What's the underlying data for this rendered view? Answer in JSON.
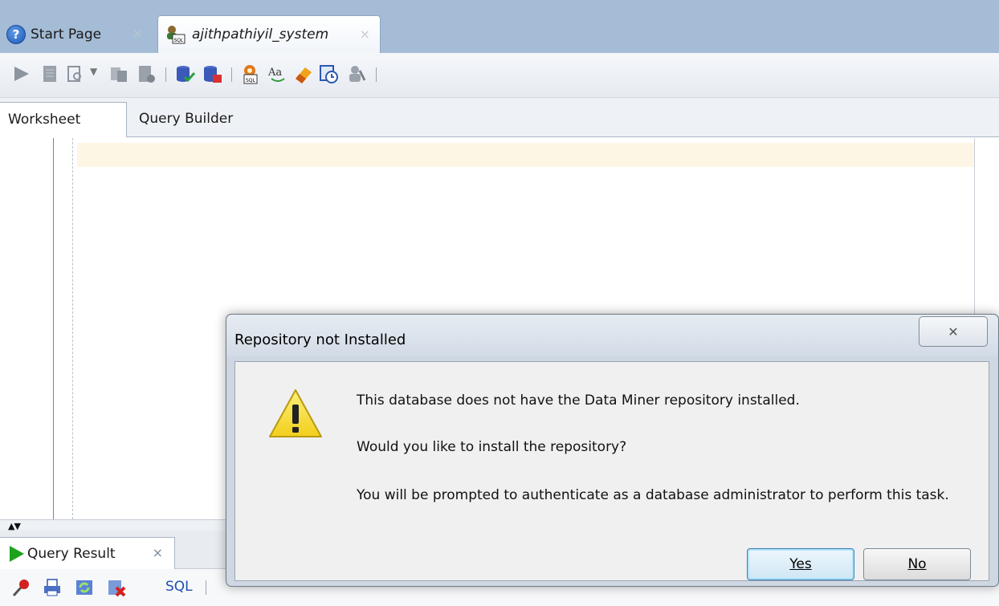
{
  "tabs": [
    {
      "label": "Start Page",
      "icon": "help-icon",
      "close": "×"
    },
    {
      "label": "ajithpathiyil_system",
      "icon": "sql-connection-icon",
      "close": "×"
    }
  ],
  "editor_tabs": {
    "worksheet": "Worksheet",
    "query_builder": "Query Builder"
  },
  "result_panel": {
    "tab_label": "Query Result",
    "close": "×",
    "sql_label": "SQL",
    "splitter_glyph": "▲▼"
  },
  "dialog": {
    "title": "Repository not Installed",
    "close_glyph": "✕",
    "message_1": "This database does not have the Data Miner repository installed.",
    "message_2": "Would you like to install the repository?",
    "message_3": "You will be prompted to authenticate as a database administrator to perform this task.",
    "yes_label": "Yes",
    "no_label": "No"
  },
  "colors": {
    "tabbar": "#a5bcd6",
    "current_line": "#fdf6e4",
    "warning": "#f6d42a",
    "run_green": "#1ca21c"
  }
}
